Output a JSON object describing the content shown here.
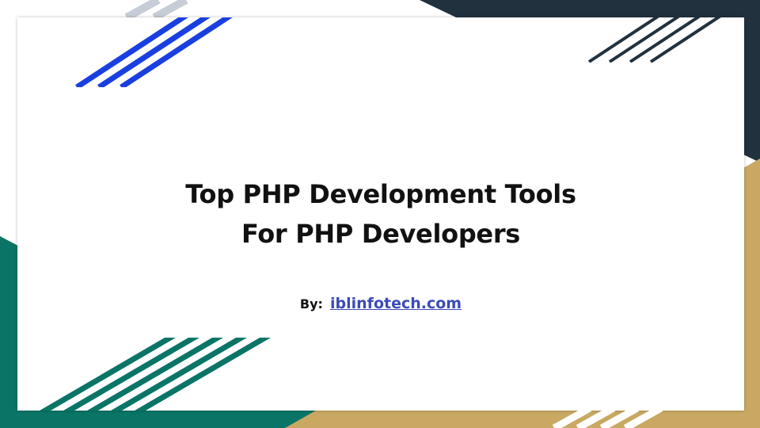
{
  "slide": {
    "title_line1": "Top PHP Development Tools",
    "title_line2": "For PHP Developers",
    "by_label": "By:",
    "link_text": "iblinfotech.com"
  },
  "colors": {
    "blue_stripe": "#1a3fe0",
    "dark_navy": "#21313e",
    "teal": "#0a7566",
    "gold": "#c9a862",
    "link": "#3b4bb8",
    "text": "#111111"
  },
  "decor": {
    "top_left": "blue-diagonal-stripes",
    "top_right": "navy-diagonal-stripes",
    "bottom_left": "teal-diagonal-stripes",
    "bottom_right": "gold-diagonal-stripes"
  }
}
